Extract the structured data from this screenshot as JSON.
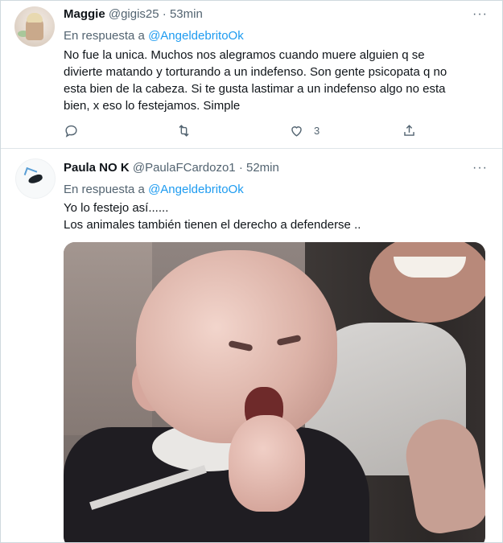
{
  "tweets": [
    {
      "name": "Maggie",
      "handle": "@gigis25",
      "time": "· 53min",
      "reply_prefix": "En respuesta a",
      "reply_to": "@AngeldebritoOk",
      "text_lines": [
        "No fue la unica. Muchos nos alegramos cuando muere alguien q se",
        "divierte matando y torturando a un indefenso. Son gente psicopata q no",
        "esta bien de la cabeza. Si te gusta lastimar a un indefenso algo no esta",
        "bien, x eso lo festejamos. Simple"
      ],
      "like_count": "3",
      "more": "···"
    },
    {
      "name": "Paula NO K",
      "handle": "@PaulaFCardozo1",
      "time": "· 52min",
      "reply_prefix": "En respuesta a",
      "reply_to": "@AngeldebritoOk",
      "text_lines": [
        "Yo lo festejo así......",
        "Los animales también  tienen el derecho a defenderse .."
      ],
      "more": "···"
    }
  ],
  "icons": [
    "reply-icon",
    "retweet-icon",
    "like-icon",
    "share-icon",
    "more-icon"
  ],
  "colors": {
    "link": "#1d9bf0",
    "secondary": "#536471",
    "text": "#0f1419"
  }
}
